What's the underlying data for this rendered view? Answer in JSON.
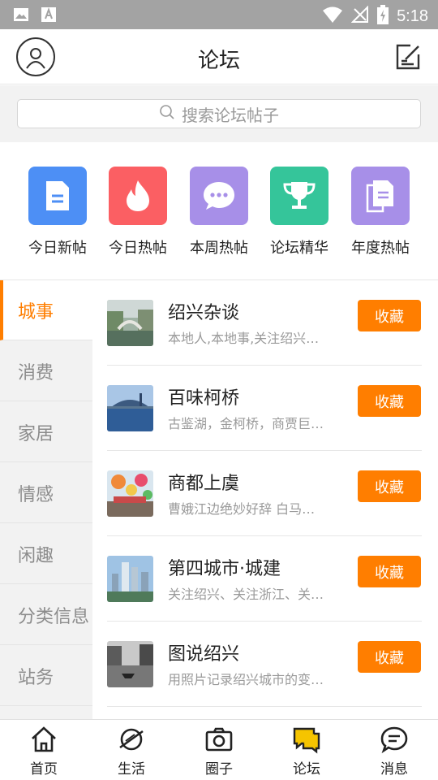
{
  "status_bar": {
    "time": "5:18",
    "icons": [
      "image-icon",
      "a-icon",
      "wifi-icon",
      "no-signal-icon",
      "battery-charging-icon"
    ]
  },
  "header": {
    "title": "论坛",
    "left_icon": "user-icon",
    "right_icon": "compose-icon"
  },
  "search": {
    "placeholder": "搜索论坛帖子",
    "icon": "search-icon"
  },
  "quick_links": [
    {
      "label": "今日新帖",
      "icon": "document-icon",
      "color": "#4d8ff5"
    },
    {
      "label": "今日热帖",
      "icon": "flame-icon",
      "color": "#fb5f63"
    },
    {
      "label": "本周热帖",
      "icon": "chat-bubble-icon",
      "color": "#a78fe8"
    },
    {
      "label": "论坛精华",
      "icon": "trophy-icon",
      "color": "#35c59a"
    },
    {
      "label": "年度热帖",
      "icon": "copy-document-icon",
      "color": "#a78fe8"
    }
  ],
  "categories": [
    {
      "label": "城事",
      "active": true
    },
    {
      "label": "消费",
      "active": false
    },
    {
      "label": "家居",
      "active": false
    },
    {
      "label": "情感",
      "active": false
    },
    {
      "label": "闲趣",
      "active": false
    },
    {
      "label": "分类信息",
      "active": false
    },
    {
      "label": "站务",
      "active": false
    }
  ],
  "forums": [
    {
      "name": "绍兴杂谈",
      "desc": "本地人,本地事,关注绍兴…",
      "button": "收藏"
    },
    {
      "name": "百味柯桥",
      "desc": "古鉴湖，金柯桥，商贾巨…",
      "button": "收藏"
    },
    {
      "name": "商都上虞",
      "desc": "曹娥江边绝妙好辞 白马…",
      "button": "收藏"
    },
    {
      "name": "第四城市·城建",
      "desc": "关注绍兴、关注浙江、关…",
      "button": "收藏"
    },
    {
      "name": "图说绍兴",
      "desc": "用照片记录绍兴城市的变…",
      "button": "收藏"
    }
  ],
  "bottom_nav": [
    {
      "label": "首页",
      "icon": "home-icon",
      "active": false
    },
    {
      "label": "生活",
      "icon": "planet-icon",
      "active": false
    },
    {
      "label": "圈子",
      "icon": "camera-icon",
      "active": false
    },
    {
      "label": "论坛",
      "icon": "forum-chat-icon",
      "active": true
    },
    {
      "label": "消息",
      "icon": "message-icon",
      "active": false
    }
  ],
  "colors": {
    "accent": "#ff7e00",
    "status_bar": "#a3a3a3",
    "sidebar_bg": "#f2f2f2",
    "active_nav_icon": "#f5c400"
  }
}
